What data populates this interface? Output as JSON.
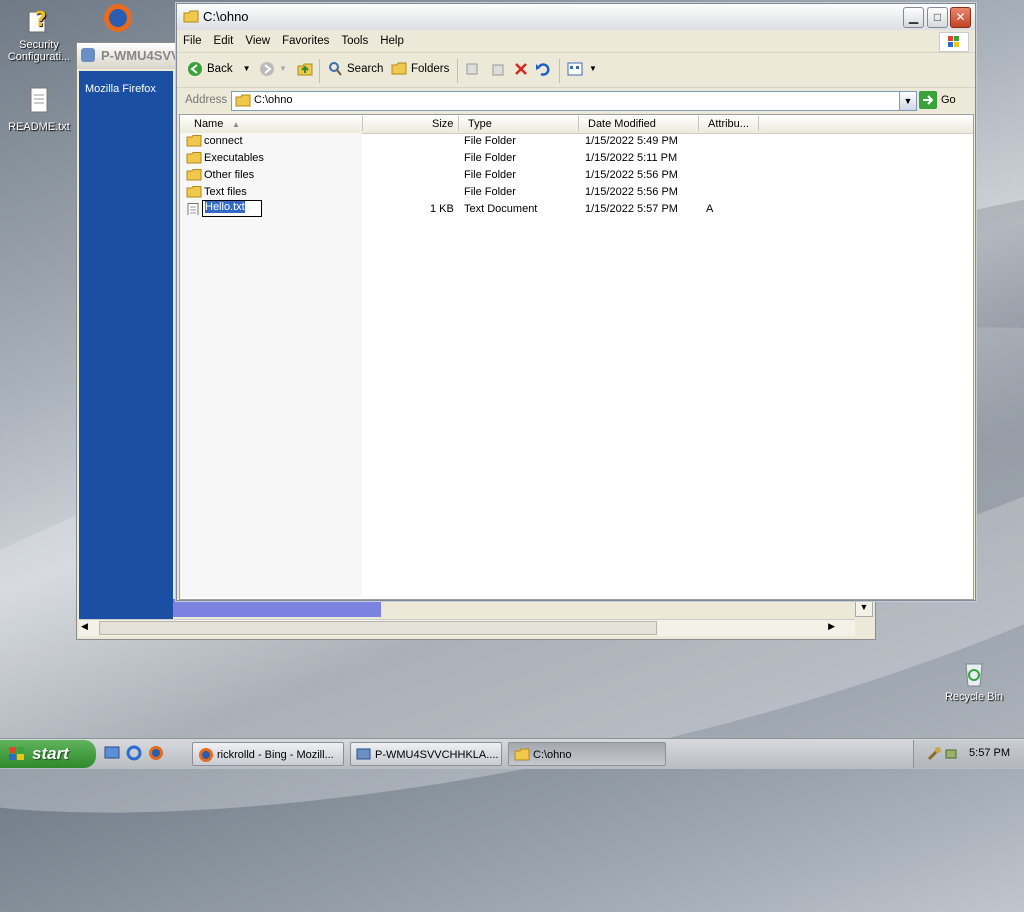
{
  "desktop": {
    "icons": [
      {
        "label": "Security Configurati..."
      },
      {
        "label": "README.txt"
      },
      {
        "label": "Recycle Bin"
      }
    ]
  },
  "background_window": {
    "title": "P-WMU4SVV",
    "panel_link": "Mozilla Firefox"
  },
  "explorer": {
    "title": "C:\\ohno",
    "menu": [
      "File",
      "Edit",
      "View",
      "Favorites",
      "Tools",
      "Help"
    ],
    "toolbar": {
      "back": "Back",
      "search": "Search",
      "folders": "Folders"
    },
    "address": {
      "label": "Address",
      "value": "C:\\ohno",
      "go": "Go"
    },
    "columns": [
      "Name",
      "Size",
      "Type",
      "Date Modified",
      "Attribu..."
    ],
    "rows": [
      {
        "name": "connect",
        "size": "",
        "type": "File Folder",
        "date": "1/15/2022 5:49 PM",
        "attr": ""
      },
      {
        "name": "Executables",
        "size": "",
        "type": "File Folder",
        "date": "1/15/2022 5:11 PM",
        "attr": ""
      },
      {
        "name": "Other files",
        "size": "",
        "type": "File Folder",
        "date": "1/15/2022 5:56 PM",
        "attr": ""
      },
      {
        "name": "Text files",
        "size": "",
        "type": "File Folder",
        "date": "1/15/2022 5:56 PM",
        "attr": ""
      },
      {
        "name": "Hello.txt",
        "size": "1 KB",
        "type": "Text Document",
        "date": "1/15/2022 5:57 PM",
        "attr": "A"
      }
    ]
  },
  "taskbar": {
    "start": "start",
    "tasks": [
      "rickrolld - Bing - Mozill...",
      "P-WMU4SVVCHHKLA....",
      "C:\\ohno"
    ],
    "clock": "5:57 PM"
  },
  "colors": {
    "accent": "#316ac5",
    "start_green": "#3c9a39"
  }
}
